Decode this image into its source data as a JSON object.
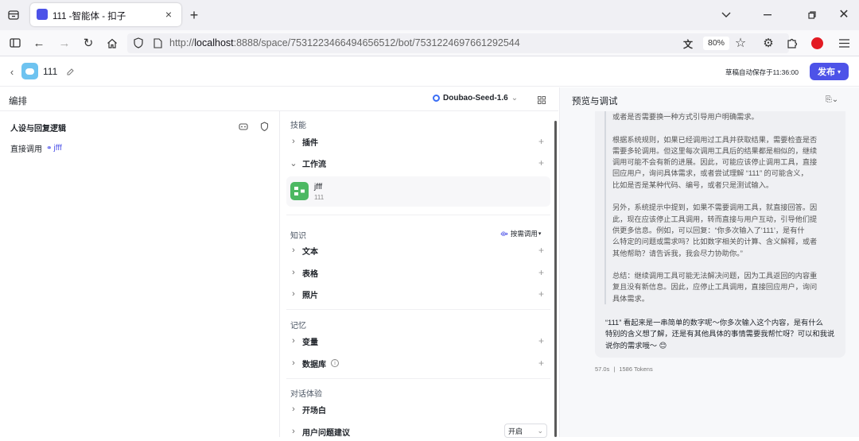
{
  "browser": {
    "tab_title": "111 -智能体 - 扣子",
    "url_prefix": "http://",
    "url_host": "localhost",
    "url_rest": ":8888/space/7531223466494656512/bot/7531224697661292544",
    "zoom": "80%"
  },
  "app": {
    "bot_name": "111",
    "autosave": "草稿自动保存于11:36:00",
    "publish_label": "发布"
  },
  "left_panel": {
    "title": "编排",
    "model": "Doubao-Seed-1.6"
  },
  "persona": {
    "title": "人设与回复逻辑",
    "text_prefix": "直接调用",
    "workflow_ref": "jfff"
  },
  "skills": {
    "section_label": "技能",
    "plugin_label": "插件",
    "workflow_label": "工作流",
    "workflow_item": {
      "name": "jfff",
      "desc": "111"
    },
    "knowledge_label": "知识",
    "knowledge_mode": "按需调用",
    "text_label": "文本",
    "table_label": "表格",
    "photo_label": "照片",
    "memory_label": "记忆",
    "variable_label": "变量",
    "database_label": "数据库",
    "dialog_label": "对话体验",
    "opening_label": "开场白",
    "suggest_label": "用户问题建议",
    "suggest_value": "开启"
  },
  "preview": {
    "title": "预览与调试",
    "think_lines": [
      "或者是否需要换一种方式引导用户明确需求。",
      "",
      "根据系统规则，如果已经调用过工具并获取结果，需要检查是否",
      "需要多轮调用。但这里每次调用工具后的结果都是相似的，继续",
      "调用可能不会有新的进展。因此，可能应该停止调用工具，直接",
      "回应用户，询问具体需求，或者尝试理解 “111” 的可能含义，",
      "比如是否是某种代码、编号，或者只是测试输入。",
      "",
      "另外，系统提示中提到，如果不需要调用工具，就直接回答。因",
      "此，现在应该停止工具调用，转而直接与用户互动，引导他们提",
      "供更多信息。例如，可以回复：“你多次输入了‘111’，是有什",
      "么特定的问题或需求吗？比如数字相关的计算、含义解释，或者",
      "其他帮助？请告诉我，我会尽力协助你。”",
      "",
      "总结：继续调用工具可能无法解决问题，因为工具返回的内容重",
      "复且没有新信息。因此，应停止工具调用，直接回应用户，询问",
      "具体需求。"
    ],
    "answer_lines": [
      "“111” 看起来是一串简单的数字呢～你多次输入这个内容，是有什么",
      "特别的含义想了解，还是有其他具体的事情需要我帮忙呀？可以和我说",
      "说你的需求哦～ 😊"
    ],
    "stats_time": "57.0s",
    "stats_tokens": "1586 Tokens"
  }
}
